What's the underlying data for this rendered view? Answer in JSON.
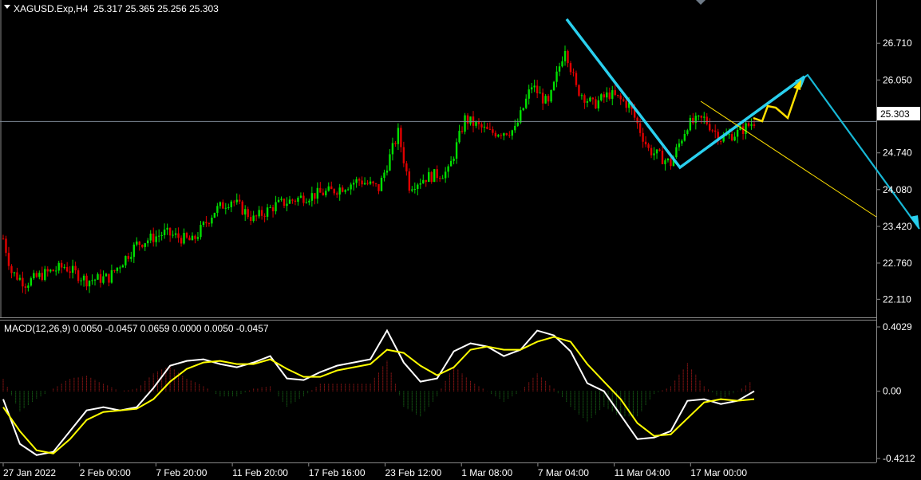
{
  "chart_data": [
    {
      "type": "candlestick",
      "symbol_header": "XAGUSD.Exp,H4",
      "ohlc_header": "25.317 25.365 25.256 25.303",
      "current_price_label": "25.303",
      "ylim": [
        21.9,
        27.2
      ],
      "y_ticks": [
        "26.710",
        "26.050",
        "25.390",
        "24.740",
        "24.080",
        "23.420",
        "22.760",
        "22.110"
      ],
      "x_ticks": [
        "27 Jan 2022",
        "2 Feb 00:00",
        "7 Feb 20:00",
        "11 Feb 20:00",
        "17 Feb 16:00",
        "23 Feb 12:00",
        "1 Mar 08:00",
        "7 Mar 04:00",
        "11 Mar 04:00",
        "17 Mar 00:00"
      ],
      "close_path": [
        {
          "bar": 0,
          "price": 23.2
        },
        {
          "bar": 3,
          "price": 22.6
        },
        {
          "bar": 8,
          "price": 22.4
        },
        {
          "bar": 14,
          "price": 22.55
        },
        {
          "bar": 22,
          "price": 22.7
        },
        {
          "bar": 30,
          "price": 22.45
        },
        {
          "bar": 38,
          "price": 22.5
        },
        {
          "bar": 48,
          "price": 23.1
        },
        {
          "bar": 58,
          "price": 23.3
        },
        {
          "bar": 68,
          "price": 23.15
        },
        {
          "bar": 76,
          "price": 23.7
        },
        {
          "bar": 82,
          "price": 23.9
        },
        {
          "bar": 90,
          "price": 23.55
        },
        {
          "bar": 98,
          "price": 23.8
        },
        {
          "bar": 108,
          "price": 23.95
        },
        {
          "bar": 118,
          "price": 24.05
        },
        {
          "bar": 128,
          "price": 24.25
        },
        {
          "bar": 135,
          "price": 24.1
        },
        {
          "bar": 142,
          "price": 25.1
        },
        {
          "bar": 146,
          "price": 24.15
        },
        {
          "bar": 152,
          "price": 24.3
        },
        {
          "bar": 160,
          "price": 24.4
        },
        {
          "bar": 166,
          "price": 25.35
        },
        {
          "bar": 175,
          "price": 25.1
        },
        {
          "bar": 184,
          "price": 25.15
        },
        {
          "bar": 190,
          "price": 25.95
        },
        {
          "bar": 196,
          "price": 25.6
        },
        {
          "bar": 202,
          "price": 26.65
        },
        {
          "bar": 206,
          "price": 25.9
        },
        {
          "bar": 212,
          "price": 25.6
        },
        {
          "bar": 218,
          "price": 25.8
        },
        {
          "bar": 225,
          "price": 25.6
        },
        {
          "bar": 232,
          "price": 24.8
        },
        {
          "bar": 240,
          "price": 24.55
        },
        {
          "bar": 246,
          "price": 25.25
        },
        {
          "bar": 252,
          "price": 25.35
        },
        {
          "bar": 258,
          "price": 25.0
        },
        {
          "bar": 264,
          "price": 25.1
        },
        {
          "bar": 270,
          "price": 25.303
        }
      ],
      "price_line": 25.303,
      "macd": {
        "header": "MACD(12,26,9) 0.0050 -0.0457 0.0659 0.0000 0.0050 -0.0457",
        "ylim": [
          -0.4212,
          0.4029
        ],
        "y_ticks": [
          "0.4029",
          "0.00",
          "-0.4212"
        ],
        "series": [
          {
            "color": "#ffffff",
            "points": [
              -0.05,
              -0.33,
              -0.4,
              -0.38,
              -0.25,
              -0.12,
              -0.1,
              -0.12,
              -0.1,
              0.02,
              0.16,
              0.19,
              0.2,
              0.17,
              0.15,
              0.18,
              0.22,
              0.08,
              0.07,
              0.12,
              0.16,
              0.18,
              0.2,
              0.38,
              0.18,
              0.06,
              0.08,
              0.25,
              0.3,
              0.28,
              0.22,
              0.26,
              0.38,
              0.35,
              0.25,
              0.05,
              0.0,
              -0.15,
              -0.3,
              -0.29,
              -0.25,
              -0.06,
              -0.05,
              -0.08,
              -0.06,
              0.0
            ]
          },
          {
            "color": "#ffff00",
            "points": [
              -0.1,
              -0.25,
              -0.37,
              -0.39,
              -0.3,
              -0.18,
              -0.13,
              -0.12,
              -0.11,
              -0.05,
              0.06,
              0.14,
              0.18,
              0.19,
              0.17,
              0.17,
              0.2,
              0.14,
              0.09,
              0.09,
              0.13,
              0.15,
              0.17,
              0.26,
              0.24,
              0.16,
              0.1,
              0.15,
              0.26,
              0.28,
              0.26,
              0.26,
              0.31,
              0.34,
              0.31,
              0.17,
              0.06,
              -0.05,
              -0.2,
              -0.28,
              -0.27,
              -0.17,
              -0.07,
              -0.05,
              -0.06,
              -0.05
            ]
          }
        ]
      }
    }
  ]
}
